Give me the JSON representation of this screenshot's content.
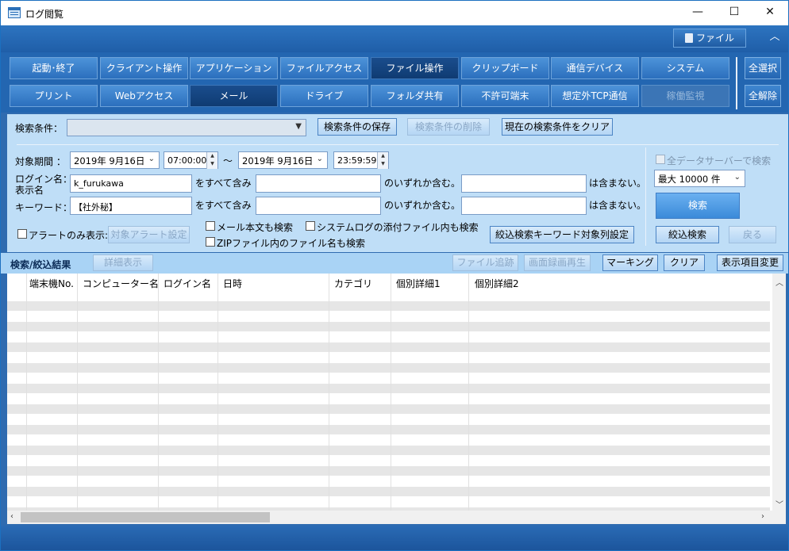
{
  "window": {
    "title": "ログ閲覧",
    "minimize": "—",
    "maximize": "☐",
    "close": "✕"
  },
  "topbar": {
    "file_label": "ファイル",
    "collapse": "︿"
  },
  "tabs_row1": [
    "起動･終了",
    "クライアント操作",
    "アプリケーション",
    "ファイルアクセス",
    "ファイル操作",
    "クリップボード",
    "通信デバイス",
    "システム"
  ],
  "tabs_row2": [
    "プリント",
    "Webアクセス",
    "メール",
    "ドライブ",
    "フォルダ共有",
    "不許可端末",
    "想定外TCP通信",
    "稼働監視"
  ],
  "tab_selected": [
    "ファイル操作",
    "メール"
  ],
  "tab_disabled": [
    "稼働監視"
  ],
  "select_all": "全選択",
  "deselect_all": "全解除",
  "search": {
    "cond_label": "検索条件：",
    "cond_value": "",
    "save_cond": "検索条件の保存",
    "delete_cond": "検索条件の削除",
    "clear_cond": "現在の検索条件をクリア",
    "period_label": "対象期間 ：",
    "start_date": "2019年 9月16日",
    "start_time": "07:00:00",
    "tilde": "～",
    "end_date": "2019年 9月16日",
    "end_time": "23:59:59",
    "login_label1": "ログイン名：",
    "login_label2": "表示名",
    "login_value": "k_furukawa",
    "contains_all": "をすべて含み",
    "contains_any": "のいずれか含む。",
    "not_contains": "は含まない。",
    "keyword_label": "キーワード：",
    "keyword_value": "【社外秘】",
    "alert_only": "アラートのみ表示:",
    "alert_setting": "対象アラート設定",
    "mail_body": "メール本文も検索",
    "syslog_attach": "システムログの添付ファイル内も検索",
    "zip_name": "ZIPファイル内のファイル名も検索",
    "filter_keyword_cols": "絞込検索キーワード対象列設定",
    "all_servers": "全データサーバーで検索",
    "max_count": "最大 10000 件",
    "search_btn": "検索",
    "filter_btn": "絞込検索",
    "back_btn": "戻る"
  },
  "results": {
    "title": "検索/絞込結果",
    "detail_btn": "詳細表示",
    "file_trace": "ファイル追跡",
    "screen_replay": "画面録画再生",
    "marking": "マーキング",
    "clear": "クリア",
    "change_columns": "表示項目変更",
    "columns": [
      "端末機No.",
      "コンピューター名",
      "ログイン名",
      "日時",
      "カテゴリ",
      "個別詳細1",
      "個別詳細2"
    ]
  }
}
